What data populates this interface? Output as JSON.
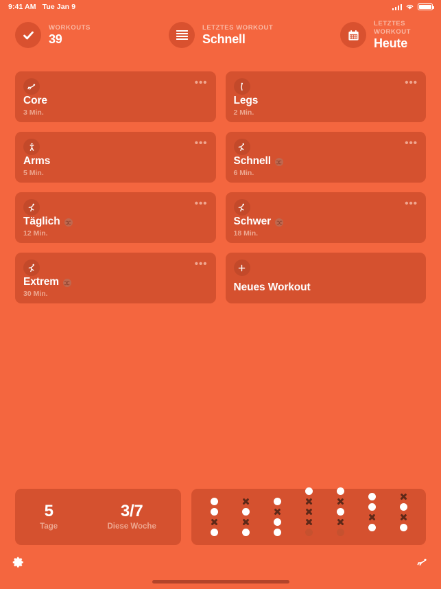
{
  "status_bar": {
    "time": "9:41 AM",
    "date": "Tue Jan 9",
    "signal_icon": "cellular-signal-icon",
    "wifi_icon": "wifi-icon",
    "battery_icon": "battery-icon"
  },
  "header": {
    "stats": [
      {
        "icon": "checkmark-icon",
        "label": "WORKOUTS",
        "value": "39"
      },
      {
        "icon": "list-icon",
        "label": "LETZTES WORKOUT",
        "value": "Schnell"
      },
      {
        "icon": "calendar-icon",
        "label": "LETZTES WORKOUT",
        "value": "Heute"
      }
    ]
  },
  "workouts": [
    {
      "icon": "core-exercise-icon",
      "title": "Core",
      "duration": "3 Min.",
      "shuffle": false,
      "more": "•••",
      "new": false
    },
    {
      "icon": "legs-exercise-icon",
      "title": "Legs",
      "duration": "2 Min.",
      "shuffle": false,
      "more": "•••",
      "new": false
    },
    {
      "icon": "arms-exercise-icon",
      "title": "Arms",
      "duration": "5 Min.",
      "shuffle": false,
      "more": "•••",
      "new": false
    },
    {
      "icon": "run-exercise-icon",
      "title": "Schnell",
      "duration": "6 Min.",
      "shuffle": true,
      "more": "•••",
      "new": false
    },
    {
      "icon": "run-exercise-icon",
      "title": "Täglich",
      "duration": "12 Min.",
      "shuffle": true,
      "more": "•••",
      "new": false
    },
    {
      "icon": "run-exercise-icon",
      "title": "Schwer",
      "duration": "18 Min.",
      "shuffle": true,
      "more": "•••",
      "new": false
    },
    {
      "icon": "run-exercise-icon",
      "title": "Extrem",
      "duration": "30 Min.",
      "shuffle": true,
      "more": "•••",
      "new": false
    },
    {
      "icon": "plus-icon",
      "title": "Neues Workout",
      "duration": "",
      "shuffle": false,
      "more": "",
      "new": true
    }
  ],
  "stats_panel": {
    "items": [
      {
        "number": "5",
        "caption": "Tage"
      },
      {
        "number": "3/7",
        "caption": "Diese Woche"
      }
    ]
  },
  "activity_grid": {
    "columns": [
      {
        "offset": 0,
        "marks": [
          "dot",
          "dot",
          "x",
          "dot"
        ]
      },
      {
        "offset": 0,
        "marks": [
          "x",
          "dot",
          "x",
          "dot"
        ]
      },
      {
        "offset": 0,
        "marks": [
          "dot",
          "x",
          "dot",
          "dot"
        ]
      },
      {
        "offset": 1,
        "marks": [
          "dot",
          "x",
          "x",
          "x",
          "faded"
        ]
      },
      {
        "offset": 1,
        "marks": [
          "dot",
          "x",
          "dot",
          "x",
          "faded"
        ]
      },
      {
        "offset": 1,
        "marks": [
          "dot",
          "dot",
          "x",
          "dot"
        ]
      },
      {
        "offset": 1,
        "marks": [
          "x",
          "dot",
          "x",
          "dot"
        ]
      }
    ]
  },
  "toolbar": {
    "settings_icon": "gear-icon",
    "exercise_icon": "core-exercise-icon"
  },
  "colors": {
    "background": "#f4663f",
    "card": "#d5512f",
    "card_badge": "#c3492a",
    "muted_text": "#eda68f",
    "mark_dark": "#5d2818"
  }
}
